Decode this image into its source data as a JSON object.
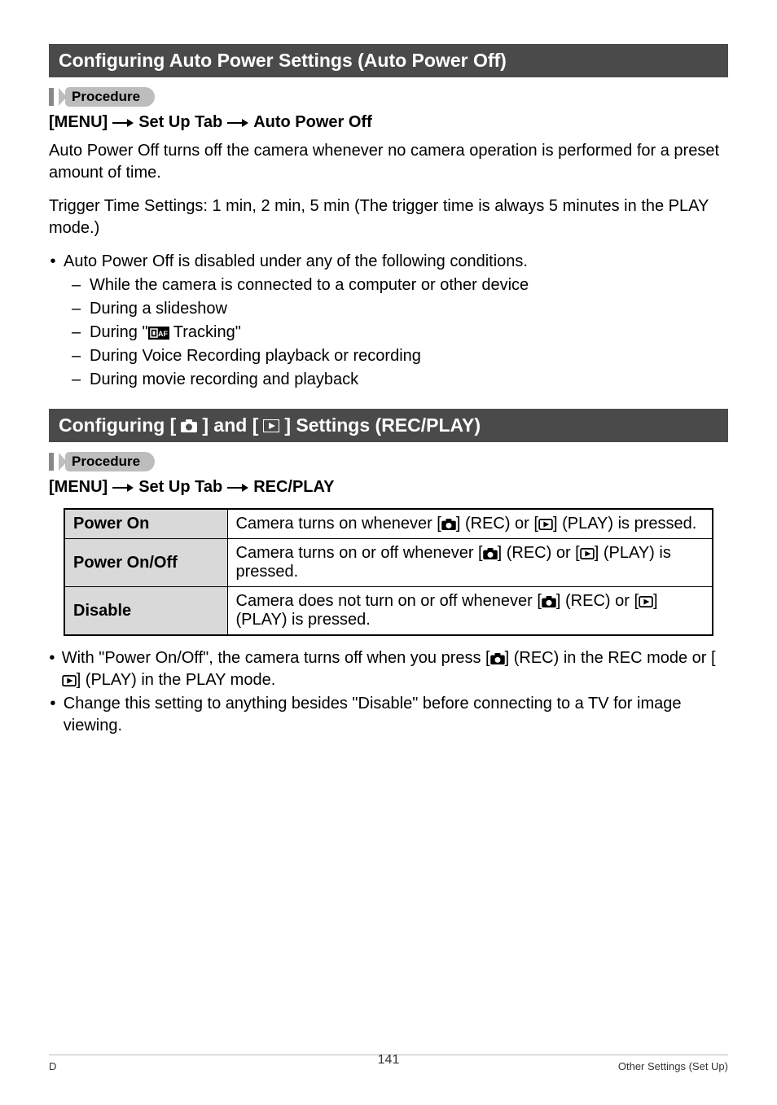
{
  "section1": {
    "title": "Configuring Auto Power Settings (Auto Power Off)",
    "procedure_label": "Procedure",
    "path": [
      "[MENU]",
      "Set Up Tab",
      "Auto Power Off"
    ],
    "para1": "Auto Power Off turns off the camera whenever no camera operation is performed for a preset amount of time.",
    "para2": "Trigger Time Settings: 1 min, 2 min, 5 min (The trigger time is always 5 minutes in the PLAY mode.)",
    "bullet_intro": "Auto Power Off is disabled under any of the following conditions.",
    "subitems": {
      "a": "While the camera is connected to a computer or other device",
      "b": "During a slideshow",
      "c_pre": "During \"",
      "c_post": " Tracking\"",
      "d": "During Voice Recording playback or recording",
      "e": "During movie recording and playback"
    }
  },
  "section2": {
    "title_parts": {
      "a": "Configuring [",
      "b": "] and [",
      "c": "] Settings (REC/PLAY)"
    },
    "procedure_label": "Procedure",
    "path": [
      "[MENU]",
      "Set Up Tab",
      "REC/PLAY"
    ],
    "table": {
      "rows": [
        {
          "label": "Power On",
          "desc": {
            "a": "Camera turns on whenever [",
            "b": "] (REC) or [",
            "c": "] (PLAY) is pressed."
          }
        },
        {
          "label": "Power On/Off",
          "desc": {
            "a": "Camera turns on or off whenever [",
            "b": "] (REC) or [",
            "c": "] (PLAY) is pressed."
          }
        },
        {
          "label": "Disable",
          "desc": {
            "a": "Camera does not turn on or off whenever [",
            "b": "] (REC) or [",
            "c": "] (PLAY) is pressed."
          }
        }
      ]
    },
    "notes": {
      "n1": {
        "a": "With \"Power On/Off\", the camera turns off when you press [",
        "b": "] (REC) in the REC mode or [",
        "c": "] (PLAY) in the PLAY mode."
      },
      "n2": "Change this setting to anything besides \"Disable\" before connecting to a TV for image viewing."
    }
  },
  "footer": {
    "left": "D",
    "center": "141",
    "right": "Other Settings (Set Up)"
  }
}
